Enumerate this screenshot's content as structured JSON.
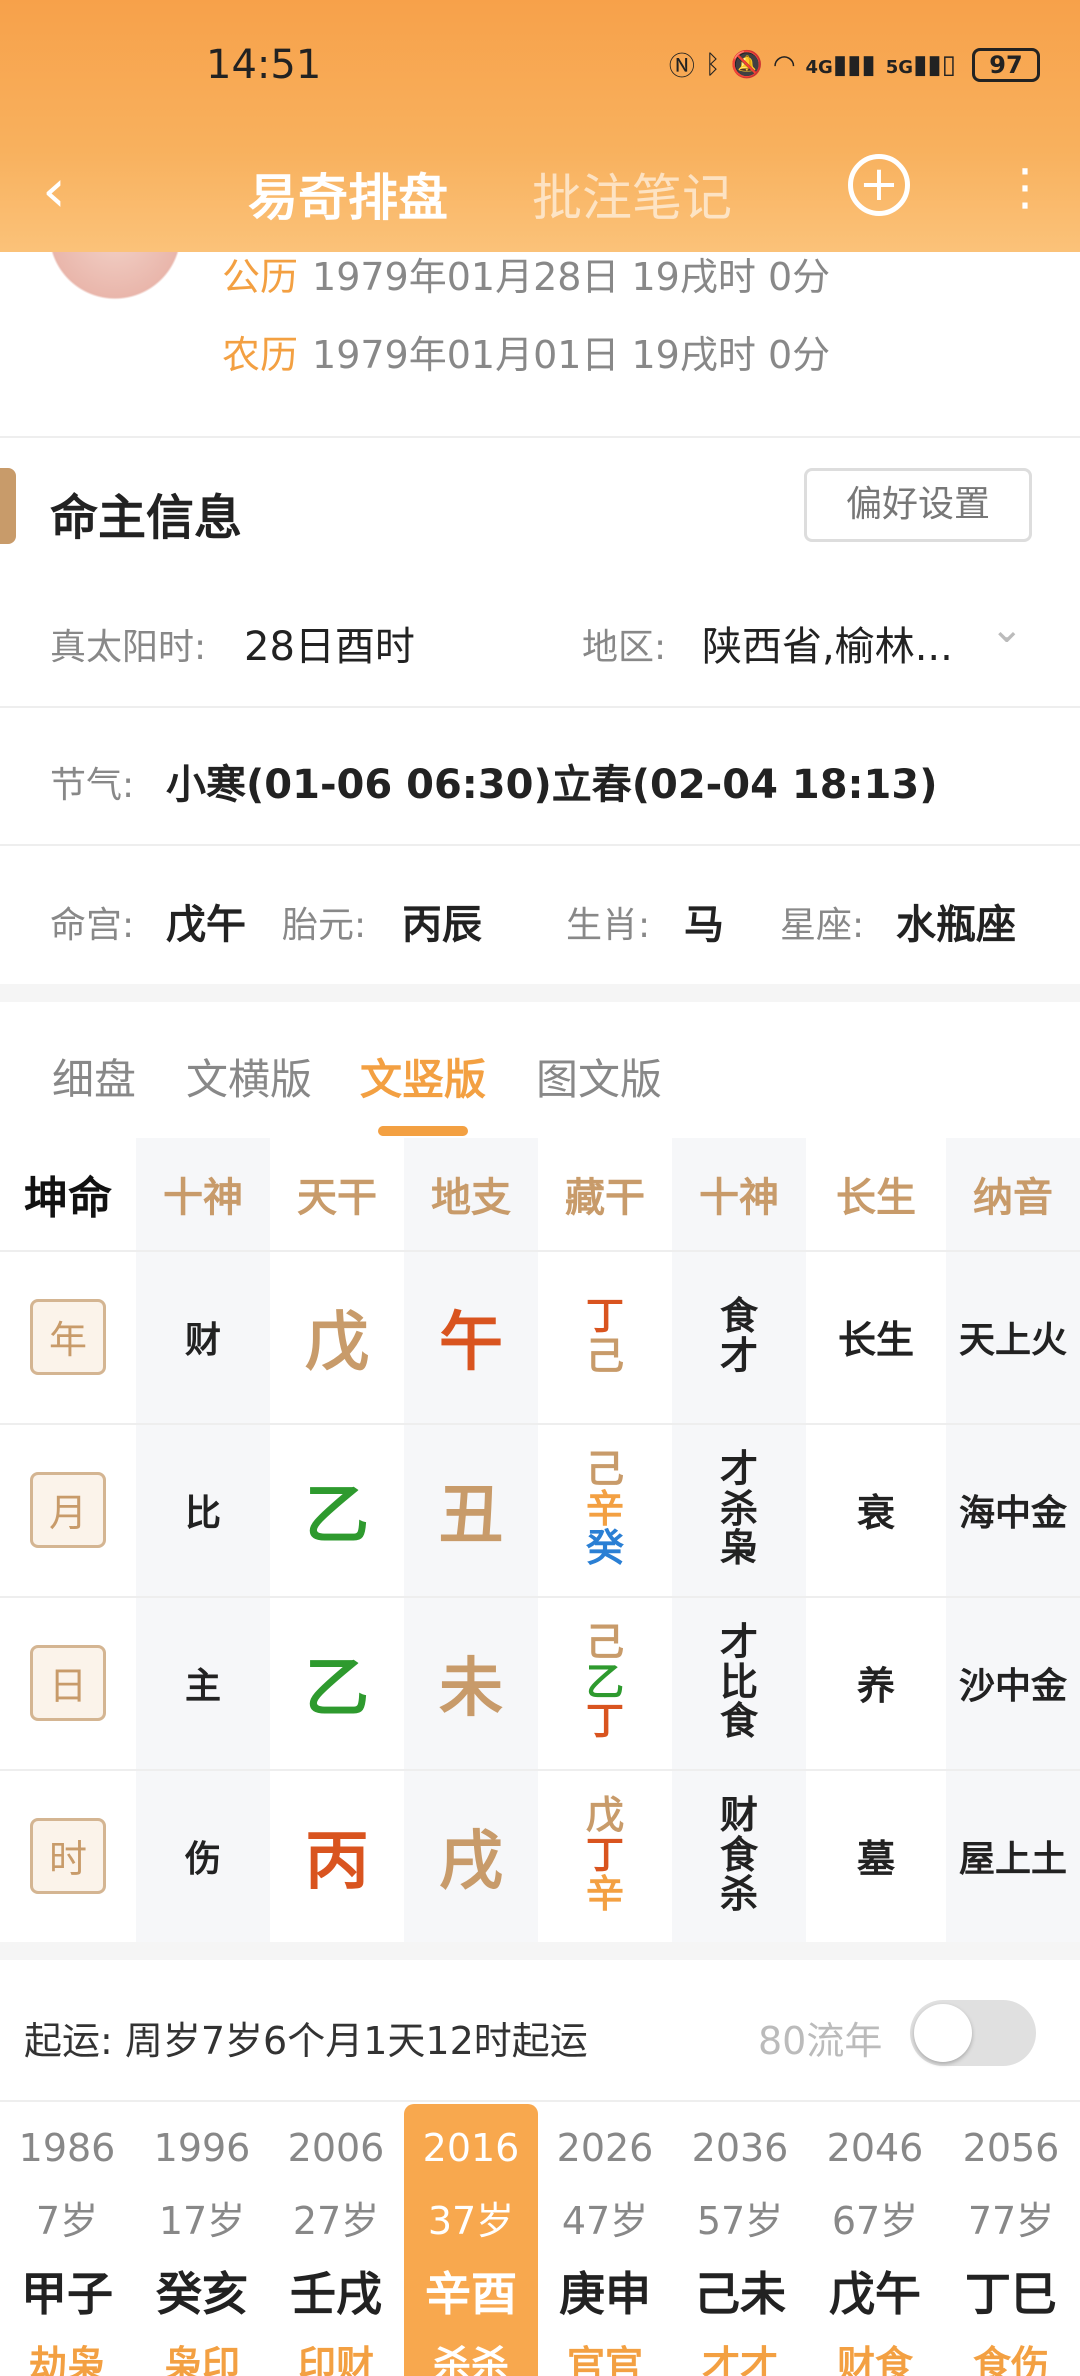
{
  "status": {
    "time": "14:51",
    "battery": "97",
    "icons": [
      "nfc-icon",
      "bluetooth-icon",
      "mute-icon",
      "wifi-icon",
      "4g-signal-icon",
      "5g-signal-icon"
    ],
    "signal_4g": "4G",
    "signal_5g": "5G"
  },
  "nav": {
    "back": "‹",
    "tab_active": "易奇排盘",
    "tab_inactive": "批注笔记",
    "plus": "+",
    "more": "⋮"
  },
  "profile": {
    "solar_label": "公历",
    "solar_value": "1979年01月28日 19戌时 0分",
    "lunar_label": "农历",
    "lunar_value": "1979年01月01日 19戌时 0分"
  },
  "section": {
    "title": "命主信息",
    "pref_button": "偏好设置"
  },
  "info": {
    "true_solar_label": "真太阳时:",
    "true_solar_value": "28日酉时",
    "region_label": "地区:",
    "region_value": "陕西省,榆林...",
    "jieqi_label": "节气:",
    "jieqi_value": "小寒(01-06 06:30)立春(02-04 18:13)",
    "minggong_label": "命宫:",
    "minggong_value": "戊午",
    "taiyuan_label": "胎元:",
    "taiyuan_value": "丙辰",
    "shengxiao_label": "生肖:",
    "shengxiao_value": "马",
    "xingzuo_label": "星座:",
    "xingzuo_value": "水瓶座"
  },
  "view_tabs": [
    "细盘",
    "文横版",
    "文竖版",
    "图文版"
  ],
  "view_tab_active": "文竖版",
  "grid": {
    "corner": "坤命",
    "headers": [
      "十神",
      "天干",
      "地支",
      "藏干",
      "十神",
      "长生",
      "纳音"
    ],
    "rows": [
      {
        "pillar": "年",
        "shishen": "财",
        "tiangan": "戊",
        "tg_color": "#c89b6a",
        "dizhi": "午",
        "dz_color": "#d9541f",
        "canggan": [
          {
            "c": "丁",
            "col": "#d9541f"
          },
          {
            "c": "己",
            "col": "#c89b6a"
          }
        ],
        "shishen2": [
          "食",
          "才"
        ],
        "changsheng": "长生",
        "nayin": "天上火"
      },
      {
        "pillar": "月",
        "shishen": "比",
        "tiangan": "乙",
        "tg_color": "#2e9a2e",
        "dizhi": "丑",
        "dz_color": "#c89b6a",
        "canggan": [
          {
            "c": "己",
            "col": "#c89b6a"
          },
          {
            "c": "辛",
            "col": "#f3a042"
          },
          {
            "c": "癸",
            "col": "#2a7fd4"
          }
        ],
        "shishen2": [
          "才",
          "杀",
          "枭"
        ],
        "changsheng": "衰",
        "nayin": "海中金"
      },
      {
        "pillar": "日",
        "shishen": "主",
        "tiangan": "乙",
        "tg_color": "#2e9a2e",
        "dizhi": "未",
        "dz_color": "#c89b6a",
        "canggan": [
          {
            "c": "己",
            "col": "#c89b6a"
          },
          {
            "c": "乙",
            "col": "#2e9a2e"
          },
          {
            "c": "丁",
            "col": "#d9541f"
          }
        ],
        "shishen2": [
          "才",
          "比",
          "食"
        ],
        "changsheng": "养",
        "nayin": "沙中金"
      },
      {
        "pillar": "时",
        "shishen": "伤",
        "tiangan": "丙",
        "tg_color": "#d9541f",
        "dizhi": "戌",
        "dz_color": "#c89b6a",
        "canggan": [
          {
            "c": "戊",
            "col": "#c89b6a"
          },
          {
            "c": "丁",
            "col": "#d9541f"
          },
          {
            "c": "辛",
            "col": "#f3a042"
          }
        ],
        "shishen2": [
          "财",
          "食",
          "杀"
        ],
        "changsheng": "墓",
        "nayin": "屋上土"
      }
    ]
  },
  "qiyun": {
    "text": "起运:  周岁7岁6个月1天12时起运",
    "liunian": "80流年",
    "toggle_on": false
  },
  "dayun": [
    {
      "year": "1986",
      "age": "7岁",
      "gz": "甲子",
      "ss": "劫枭"
    },
    {
      "year": "1996",
      "age": "17岁",
      "gz": "癸亥",
      "ss": "枭印"
    },
    {
      "year": "2006",
      "age": "27岁",
      "gz": "壬戌",
      "ss": "印财"
    },
    {
      "year": "2016",
      "age": "37岁",
      "gz": "辛酉",
      "ss": "杀杀",
      "active": true
    },
    {
      "year": "2026",
      "age": "47岁",
      "gz": "庚申",
      "ss": "官官"
    },
    {
      "year": "2036",
      "age": "57岁",
      "gz": "己未",
      "ss": "才才"
    },
    {
      "year": "2046",
      "age": "67岁",
      "gz": "戊午",
      "ss": "财食"
    },
    {
      "year": "2056",
      "age": "77岁",
      "gz": "丁巳",
      "ss": "食伤"
    }
  ],
  "colors": {
    "accent": "#f3a042",
    "gold": "#c89b6a",
    "red": "#d9541f",
    "green": "#2e9a2e",
    "blue": "#2a7fd4"
  }
}
